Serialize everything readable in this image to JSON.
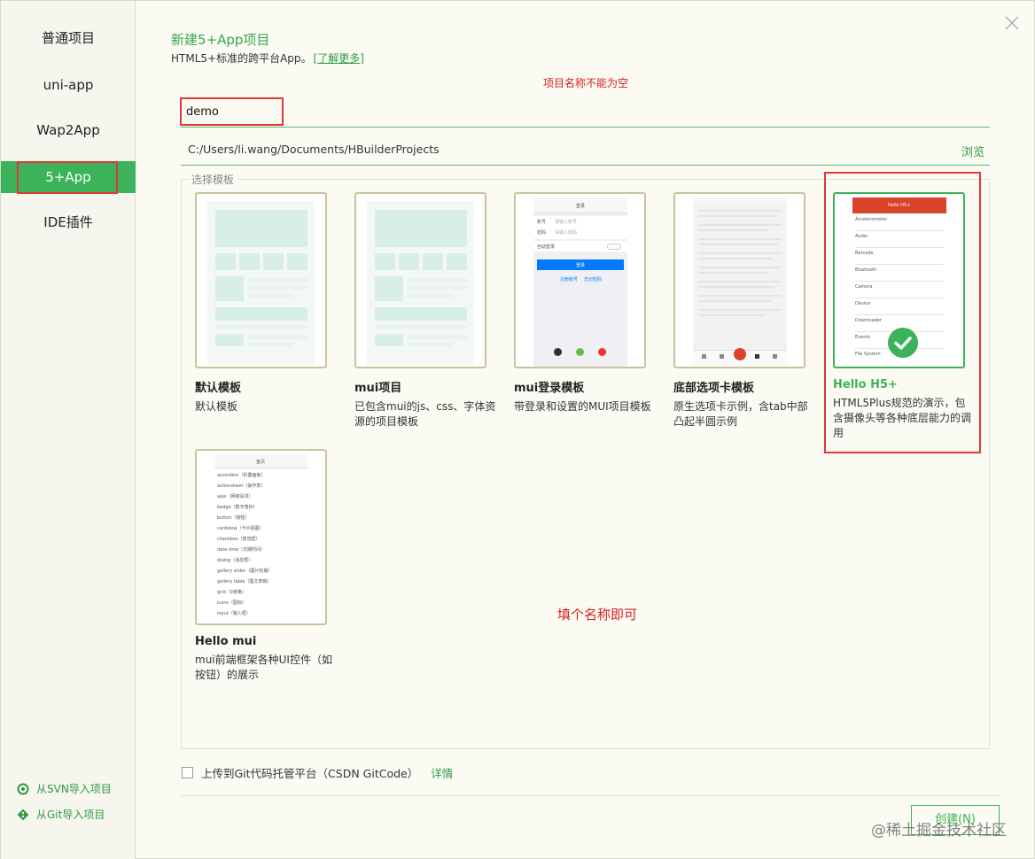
{
  "sidebar": {
    "items": [
      {
        "label": "普通项目"
      },
      {
        "label": "uni-app"
      },
      {
        "label": "Wap2App"
      },
      {
        "label": "5+App"
      },
      {
        "label": "IDE插件"
      }
    ],
    "footer": [
      {
        "label": "从SVN导入项目",
        "icon": "svn-icon"
      },
      {
        "label": "从Git导入项目",
        "icon": "git-icon"
      }
    ]
  },
  "header": {
    "title": "新建5+App项目",
    "subtitle": "HTML5+标准的跨平台App。",
    "learn_more": "[了解更多]",
    "error": "项目名称不能为空"
  },
  "form": {
    "name_value": "demo",
    "path": "C:/Users/li.wang/Documents/HBuilderProjects",
    "browse": "浏览"
  },
  "templates": {
    "legend": "选择模板",
    "items": [
      {
        "name": "默认模板",
        "desc": "默认模板"
      },
      {
        "name": "mui项目",
        "desc": "已包含mui的js、css、字体资源的项目模板"
      },
      {
        "name": "mui登录模板",
        "desc": "带登录和设置的MUI项目模板",
        "preview": {
          "title": "登录",
          "account": "账号",
          "account_ph": "请输入账号",
          "password": "密码",
          "password_ph": "请输入密码",
          "auto_login": "自动登录",
          "button": "登录",
          "register": "注册账号",
          "forgot": "忘记密码"
        }
      },
      {
        "name": "底部选项卡模板",
        "desc": "原生选项卡示例，含tab中部凸起半圆示例"
      },
      {
        "name": "Hello H5+",
        "desc": "HTML5Plus规范的演示，包含摄像头等各种底层能力的调用",
        "selected": true,
        "preview": {
          "title": "Hello H5+",
          "rows": [
            "Accelerometer",
            "Audio",
            "Barcode",
            "Bluetooth",
            "Camera",
            "Device",
            "Downloader",
            "Events",
            "File System"
          ]
        }
      },
      {
        "name": "Hello mui",
        "desc": "mui前端框架各种UI控件（如按钮）的展示",
        "preview": {
          "title": "首页",
          "rows": [
            "accordion（折叠面板）",
            "actionsheet（操作表）",
            "ajax（网络请求）",
            "badge（数字角标）",
            "button（按钮）",
            "cardview（卡片视图）",
            "checkbox（复选框）",
            "date time（日期时间）",
            "dialog（消息框）",
            "gallery slider（图片轮播）",
            "gallery table（图文表格）",
            "grid（9宫格）",
            "icons（图标）",
            "input（输入框）"
          ]
        }
      }
    ]
  },
  "hint": "填个名称即可",
  "upload": {
    "label": "上传到Git代码托管平台（CSDN GitCode）",
    "detail": "详情"
  },
  "create_button": "创建(N)",
  "watermark": "@稀土掘金技术社区",
  "colors": {
    "accent": "#3cb35a",
    "error": "#d62020",
    "background": "#fbfbf3"
  }
}
